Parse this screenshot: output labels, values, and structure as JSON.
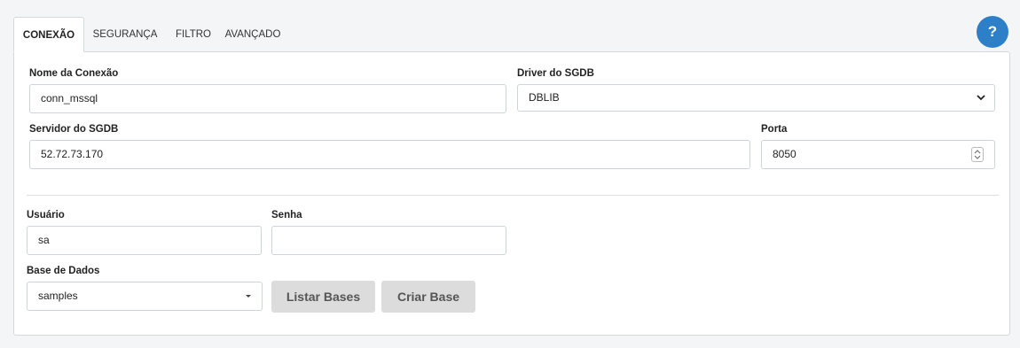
{
  "tabs": [
    {
      "label": "CONEXÃO",
      "active": true
    },
    {
      "label": "SEGURANÇA",
      "active": false
    },
    {
      "label": "FILTRO",
      "active": false
    },
    {
      "label": "AVANÇADO",
      "active": false
    }
  ],
  "help": {
    "label": "?"
  },
  "form": {
    "connection_name": {
      "label": "Nome da Conexão",
      "value": "conn_mssql"
    },
    "driver": {
      "label": "Driver do SGDB",
      "value": "DBLIB"
    },
    "server": {
      "label": "Servidor do SGDB",
      "value": "52.72.73.170"
    },
    "port": {
      "label": "Porta",
      "value": "8050"
    },
    "user": {
      "label": "Usuário",
      "value": "sa"
    },
    "password": {
      "label": "Senha",
      "value": ""
    },
    "database": {
      "label": "Base de Dados",
      "value": "samples"
    }
  },
  "buttons": {
    "list_bases": "Listar Bases",
    "create_base": "Criar Base"
  },
  "colors": {
    "accent": "#2d7fc7",
    "button_bg": "#dcdcdc",
    "page_bg": "#f4f5f7"
  }
}
